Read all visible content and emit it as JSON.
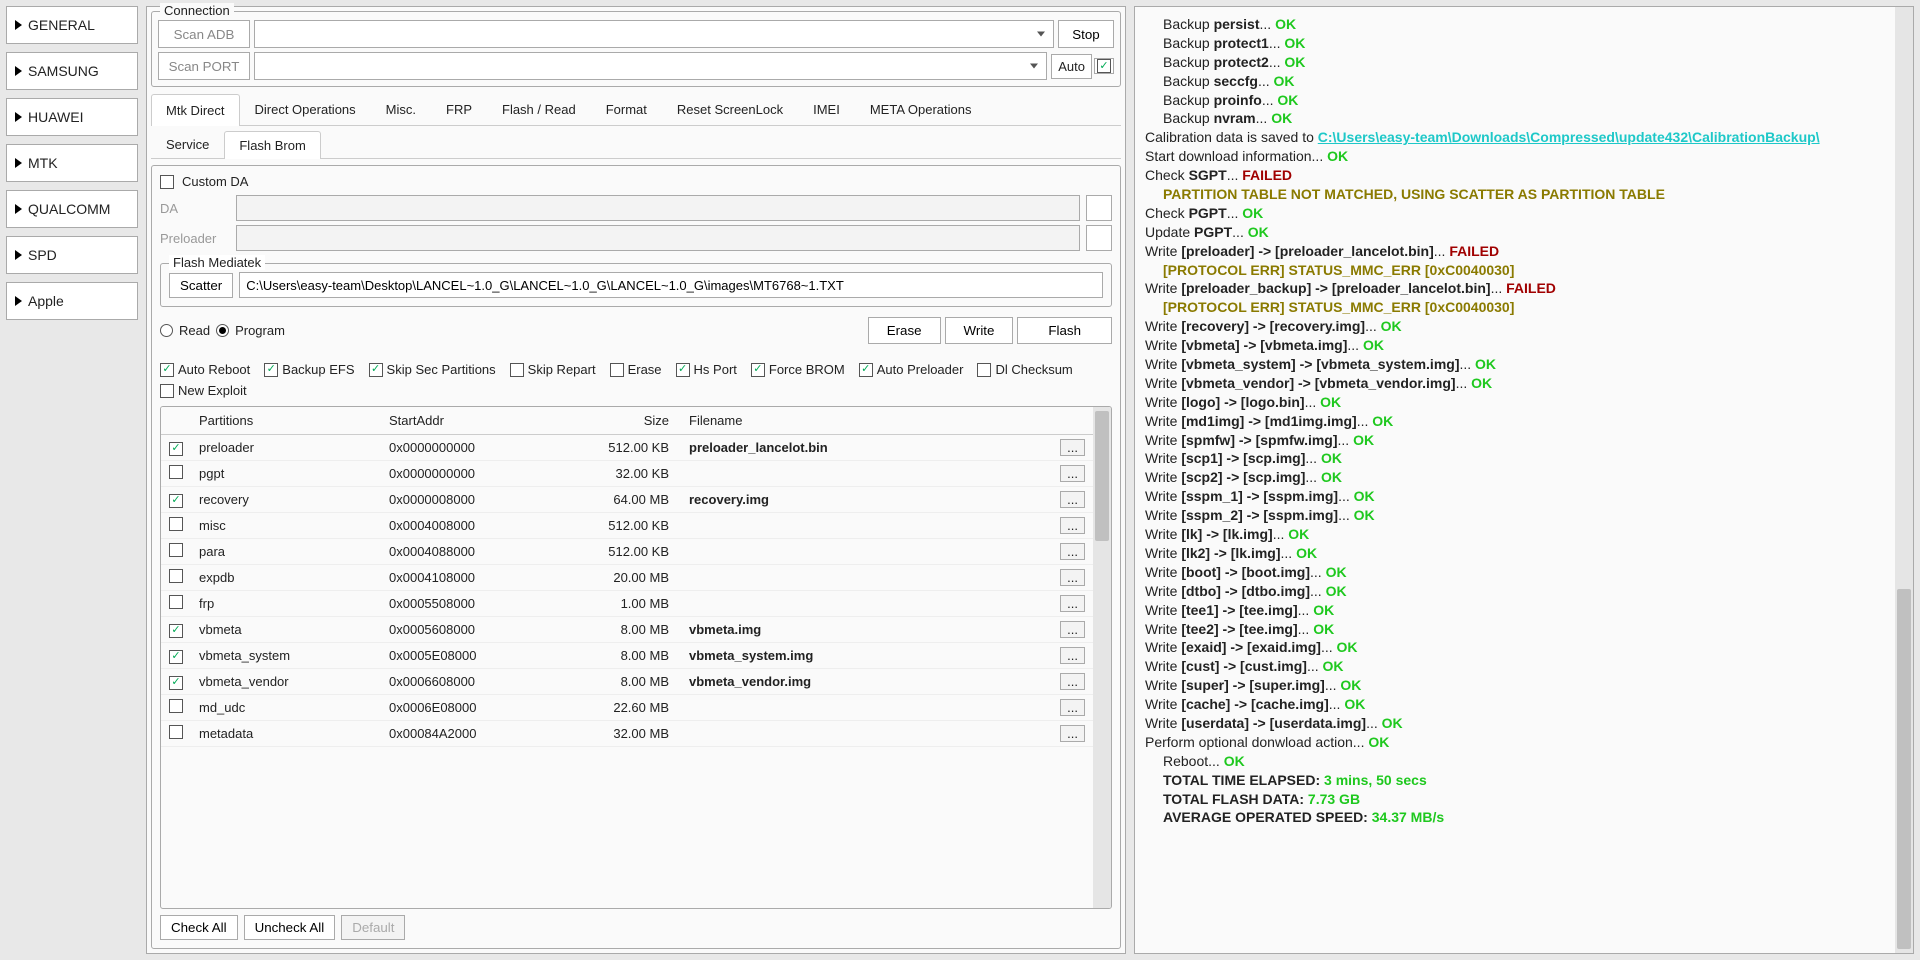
{
  "sidebar": [
    "GENERAL",
    "SAMSUNG",
    "HUAWEI",
    "MTK",
    "QUALCOMM",
    "SPD",
    "Apple"
  ],
  "sidebar_active": 3,
  "connection": {
    "legend": "Connection",
    "scan_adb": "Scan ADB",
    "scan_port": "Scan PORT",
    "stop": "Stop",
    "auto": "Auto"
  },
  "tabs": [
    "Mtk Direct",
    "Direct Operations",
    "Misc.",
    "FRP",
    "Flash / Read",
    "Format",
    "Reset ScreenLock",
    "IMEI",
    "META Operations"
  ],
  "tabs_active": 0,
  "subtabs": [
    "Service",
    "Flash Brom"
  ],
  "subtabs_active": 1,
  "custom_da": "Custom DA",
  "da_label": "DA",
  "preloader_label": "Preloader",
  "flash_med": {
    "legend": "Flash Mediatek",
    "scatter_btn": "Scatter",
    "scatter_path": "C:\\Users\\easy-team\\Desktop\\LANCEL~1.0_G\\LANCEL~1.0_G\\LANCEL~1.0_G\\images\\MT6768~1.TXT"
  },
  "radios": {
    "read": "Read",
    "program": "Program"
  },
  "actions": {
    "erase": "Erase",
    "write": "Write",
    "flash": "Flash"
  },
  "options": [
    {
      "label": "Auto Reboot",
      "on": true
    },
    {
      "label": "Backup EFS",
      "on": true
    },
    {
      "label": "Skip Sec Partitions",
      "on": true
    },
    {
      "label": "Skip Repart",
      "on": false
    },
    {
      "label": "Erase",
      "on": false
    },
    {
      "label": "Hs Port",
      "on": true
    },
    {
      "label": "Force BROM",
      "on": true
    },
    {
      "label": "Auto Preloader",
      "on": true
    },
    {
      "label": "Dl Checksum",
      "on": false
    },
    {
      "label": "New Exploit",
      "on": false
    }
  ],
  "headers": {
    "partitions": "Partitions",
    "start": "StartAddr",
    "size": "Size",
    "filename": "Filename"
  },
  "rows": [
    {
      "on": true,
      "name": "preloader",
      "addr": "0x0000000000",
      "size": "512.00 KB",
      "file": "preloader_lancelot.bin"
    },
    {
      "on": false,
      "name": "pgpt",
      "addr": "0x0000000000",
      "size": "32.00 KB",
      "file": ""
    },
    {
      "on": true,
      "name": "recovery",
      "addr": "0x0000008000",
      "size": "64.00 MB",
      "file": "recovery.img"
    },
    {
      "on": false,
      "name": "misc",
      "addr": "0x0004008000",
      "size": "512.00 KB",
      "file": ""
    },
    {
      "on": false,
      "name": "para",
      "addr": "0x0004088000",
      "size": "512.00 KB",
      "file": ""
    },
    {
      "on": false,
      "name": "expdb",
      "addr": "0x0004108000",
      "size": "20.00 MB",
      "file": ""
    },
    {
      "on": false,
      "name": "frp",
      "addr": "0x0005508000",
      "size": "1.00 MB",
      "file": ""
    },
    {
      "on": true,
      "name": "vbmeta",
      "addr": "0x0005608000",
      "size": "8.00 MB",
      "file": "vbmeta.img"
    },
    {
      "on": true,
      "name": "vbmeta_system",
      "addr": "0x0005E08000",
      "size": "8.00 MB",
      "file": "vbmeta_system.img"
    },
    {
      "on": true,
      "name": "vbmeta_vendor",
      "addr": "0x0006608000",
      "size": "8.00 MB",
      "file": "vbmeta_vendor.img"
    },
    {
      "on": false,
      "name": "md_udc",
      "addr": "0x0006E08000",
      "size": "22.60 MB",
      "file": ""
    },
    {
      "on": false,
      "name": "metadata",
      "addr": "0x00084A2000",
      "size": "32.00 MB",
      "file": ""
    }
  ],
  "bottom": {
    "check_all": "Check All",
    "uncheck_all": "Uncheck All",
    "default": "Default"
  },
  "log": [
    {
      "cls": "indent",
      "segs": [
        {
          "t": "Backup "
        },
        {
          "t": "persist",
          "b": 1
        },
        {
          "t": "... "
        },
        {
          "t": "OK",
          "c": "ok"
        }
      ]
    },
    {
      "cls": "indent",
      "segs": [
        {
          "t": "Backup "
        },
        {
          "t": "protect1",
          "b": 1
        },
        {
          "t": "... "
        },
        {
          "t": "OK",
          "c": "ok"
        }
      ]
    },
    {
      "cls": "indent",
      "segs": [
        {
          "t": "Backup "
        },
        {
          "t": "protect2",
          "b": 1
        },
        {
          "t": "... "
        },
        {
          "t": "OK",
          "c": "ok"
        }
      ]
    },
    {
      "cls": "indent",
      "segs": [
        {
          "t": "Backup "
        },
        {
          "t": "seccfg",
          "b": 1
        },
        {
          "t": "... "
        },
        {
          "t": "OK",
          "c": "ok"
        }
      ]
    },
    {
      "cls": "indent",
      "segs": [
        {
          "t": "Backup "
        },
        {
          "t": "proinfo",
          "b": 1
        },
        {
          "t": "... "
        },
        {
          "t": "OK",
          "c": "ok"
        }
      ]
    },
    {
      "cls": "indent",
      "segs": [
        {
          "t": "Backup "
        },
        {
          "t": "nvram",
          "b": 1
        },
        {
          "t": "... "
        },
        {
          "t": "OK",
          "c": "ok"
        }
      ]
    },
    {
      "segs": [
        {
          "t": "Calibration data is saved to "
        },
        {
          "t": "C:\\Users\\easy-team\\Downloads\\Compressed\\update432\\CalibrationBackup\\",
          "c": "link"
        }
      ]
    },
    {
      "segs": [
        {
          "t": "Start download information... "
        },
        {
          "t": "OK",
          "c": "ok"
        }
      ]
    },
    {
      "segs": [
        {
          "t": "Check "
        },
        {
          "t": "SGPT",
          "b": 1
        },
        {
          "t": "... "
        },
        {
          "t": "FAILED",
          "c": "fail"
        }
      ]
    },
    {
      "cls": "indent",
      "segs": [
        {
          "t": "PARTITION TABLE NOT MATCHED, USING SCATTER AS PARTITION TABLE",
          "c": "warn"
        }
      ]
    },
    {
      "segs": [
        {
          "t": "Check "
        },
        {
          "t": "PGPT",
          "b": 1
        },
        {
          "t": "... "
        },
        {
          "t": "OK",
          "c": "ok"
        }
      ]
    },
    {
      "segs": [
        {
          "t": "Update "
        },
        {
          "t": "PGPT",
          "b": 1
        },
        {
          "t": "... "
        },
        {
          "t": "OK",
          "c": "ok"
        }
      ]
    },
    {
      "segs": [
        {
          "t": "Write "
        },
        {
          "t": "[preloader] -> [preloader_lancelot.bin]",
          "b": 1
        },
        {
          "t": "... "
        },
        {
          "t": "FAILED",
          "c": "fail"
        }
      ]
    },
    {
      "cls": "indent",
      "segs": [
        {
          "t": "[PROTOCOL ERR] STATUS_MMC_ERR [0xC0040030]",
          "c": "warn"
        }
      ]
    },
    {
      "segs": [
        {
          "t": "Write "
        },
        {
          "t": "[preloader_backup] -> [preloader_lancelot.bin]",
          "b": 1
        },
        {
          "t": "... "
        },
        {
          "t": "FAILED",
          "c": "fail"
        }
      ]
    },
    {
      "cls": "indent",
      "segs": [
        {
          "t": "[PROTOCOL ERR] STATUS_MMC_ERR [0xC0040030]",
          "c": "warn"
        }
      ]
    },
    {
      "segs": [
        {
          "t": "Write "
        },
        {
          "t": "[recovery] -> [recovery.img]",
          "b": 1
        },
        {
          "t": "... "
        },
        {
          "t": "OK",
          "c": "ok"
        }
      ]
    },
    {
      "segs": [
        {
          "t": "Write "
        },
        {
          "t": "[vbmeta] -> [vbmeta.img]",
          "b": 1
        },
        {
          "t": "... "
        },
        {
          "t": "OK",
          "c": "ok"
        }
      ]
    },
    {
      "segs": [
        {
          "t": "Write "
        },
        {
          "t": "[vbmeta_system] -> [vbmeta_system.img]",
          "b": 1
        },
        {
          "t": "... "
        },
        {
          "t": "OK",
          "c": "ok"
        }
      ]
    },
    {
      "segs": [
        {
          "t": "Write "
        },
        {
          "t": "[vbmeta_vendor] -> [vbmeta_vendor.img]",
          "b": 1
        },
        {
          "t": "... "
        },
        {
          "t": "OK",
          "c": "ok"
        }
      ]
    },
    {
      "segs": [
        {
          "t": "Write "
        },
        {
          "t": "[logo] -> [logo.bin]",
          "b": 1
        },
        {
          "t": "... "
        },
        {
          "t": "OK",
          "c": "ok"
        }
      ]
    },
    {
      "segs": [
        {
          "t": "Write "
        },
        {
          "t": "[md1img] -> [md1img.img]",
          "b": 1
        },
        {
          "t": "... "
        },
        {
          "t": "OK",
          "c": "ok"
        }
      ]
    },
    {
      "segs": [
        {
          "t": "Write "
        },
        {
          "t": "[spmfw] -> [spmfw.img]",
          "b": 1
        },
        {
          "t": "... "
        },
        {
          "t": "OK",
          "c": "ok"
        }
      ]
    },
    {
      "segs": [
        {
          "t": "Write "
        },
        {
          "t": "[scp1] -> [scp.img]",
          "b": 1
        },
        {
          "t": "... "
        },
        {
          "t": "OK",
          "c": "ok"
        }
      ]
    },
    {
      "segs": [
        {
          "t": "Write "
        },
        {
          "t": "[scp2] -> [scp.img]",
          "b": 1
        },
        {
          "t": "... "
        },
        {
          "t": "OK",
          "c": "ok"
        }
      ]
    },
    {
      "segs": [
        {
          "t": "Write "
        },
        {
          "t": "[sspm_1] -> [sspm.img]",
          "b": 1
        },
        {
          "t": "... "
        },
        {
          "t": "OK",
          "c": "ok"
        }
      ]
    },
    {
      "segs": [
        {
          "t": "Write "
        },
        {
          "t": "[sspm_2] -> [sspm.img]",
          "b": 1
        },
        {
          "t": "... "
        },
        {
          "t": "OK",
          "c": "ok"
        }
      ]
    },
    {
      "segs": [
        {
          "t": "Write "
        },
        {
          "t": "[lk] -> [lk.img]",
          "b": 1
        },
        {
          "t": "... "
        },
        {
          "t": "OK",
          "c": "ok"
        }
      ]
    },
    {
      "segs": [
        {
          "t": "Write "
        },
        {
          "t": "[lk2] -> [lk.img]",
          "b": 1
        },
        {
          "t": "... "
        },
        {
          "t": "OK",
          "c": "ok"
        }
      ]
    },
    {
      "segs": [
        {
          "t": "Write "
        },
        {
          "t": "[boot] -> [boot.img]",
          "b": 1
        },
        {
          "t": "... "
        },
        {
          "t": "OK",
          "c": "ok"
        }
      ]
    },
    {
      "segs": [
        {
          "t": "Write "
        },
        {
          "t": "[dtbo] -> [dtbo.img]",
          "b": 1
        },
        {
          "t": "... "
        },
        {
          "t": "OK",
          "c": "ok"
        }
      ]
    },
    {
      "segs": [
        {
          "t": "Write "
        },
        {
          "t": "[tee1] -> [tee.img]",
          "b": 1
        },
        {
          "t": "... "
        },
        {
          "t": "OK",
          "c": "ok"
        }
      ]
    },
    {
      "segs": [
        {
          "t": "Write "
        },
        {
          "t": "[tee2] -> [tee.img]",
          "b": 1
        },
        {
          "t": "... "
        },
        {
          "t": "OK",
          "c": "ok"
        }
      ]
    },
    {
      "segs": [
        {
          "t": "Write "
        },
        {
          "t": "[exaid] -> [exaid.img]",
          "b": 1
        },
        {
          "t": "... "
        },
        {
          "t": "OK",
          "c": "ok"
        }
      ]
    },
    {
      "segs": [
        {
          "t": "Write "
        },
        {
          "t": "[cust] -> [cust.img]",
          "b": 1
        },
        {
          "t": "... "
        },
        {
          "t": "OK",
          "c": "ok"
        }
      ]
    },
    {
      "segs": [
        {
          "t": "Write "
        },
        {
          "t": "[super] -> [super.img]",
          "b": 1
        },
        {
          "t": "... "
        },
        {
          "t": "OK",
          "c": "ok"
        }
      ]
    },
    {
      "segs": [
        {
          "t": "Write "
        },
        {
          "t": "[cache] -> [cache.img]",
          "b": 1
        },
        {
          "t": "... "
        },
        {
          "t": "OK",
          "c": "ok"
        }
      ]
    },
    {
      "segs": [
        {
          "t": "Write "
        },
        {
          "t": "[userdata] -> [userdata.img]",
          "b": 1
        },
        {
          "t": "... "
        },
        {
          "t": "OK",
          "c": "ok"
        }
      ]
    },
    {
      "segs": [
        {
          "t": "Perform optional donwload action... "
        },
        {
          "t": "OK",
          "c": "ok"
        }
      ]
    },
    {
      "cls": "indent",
      "segs": [
        {
          "t": "Reboot... "
        },
        {
          "t": "OK",
          "c": "ok"
        }
      ]
    },
    {
      "cls": "indent",
      "segs": [
        {
          "t": "TOTAL TIME ELAPSED: ",
          "b": 1
        },
        {
          "t": "3 mins, 50 secs",
          "c": "ok"
        }
      ]
    },
    {
      "cls": "indent",
      "segs": [
        {
          "t": "TOTAL FLASH DATA: ",
          "b": 1
        },
        {
          "t": "7.73 GB",
          "c": "ok"
        }
      ]
    },
    {
      "cls": "indent",
      "segs": [
        {
          "t": "AVERAGE OPERATED SPEED: ",
          "b": 1
        },
        {
          "t": "34.37 MB/s",
          "c": "ok"
        }
      ]
    }
  ]
}
